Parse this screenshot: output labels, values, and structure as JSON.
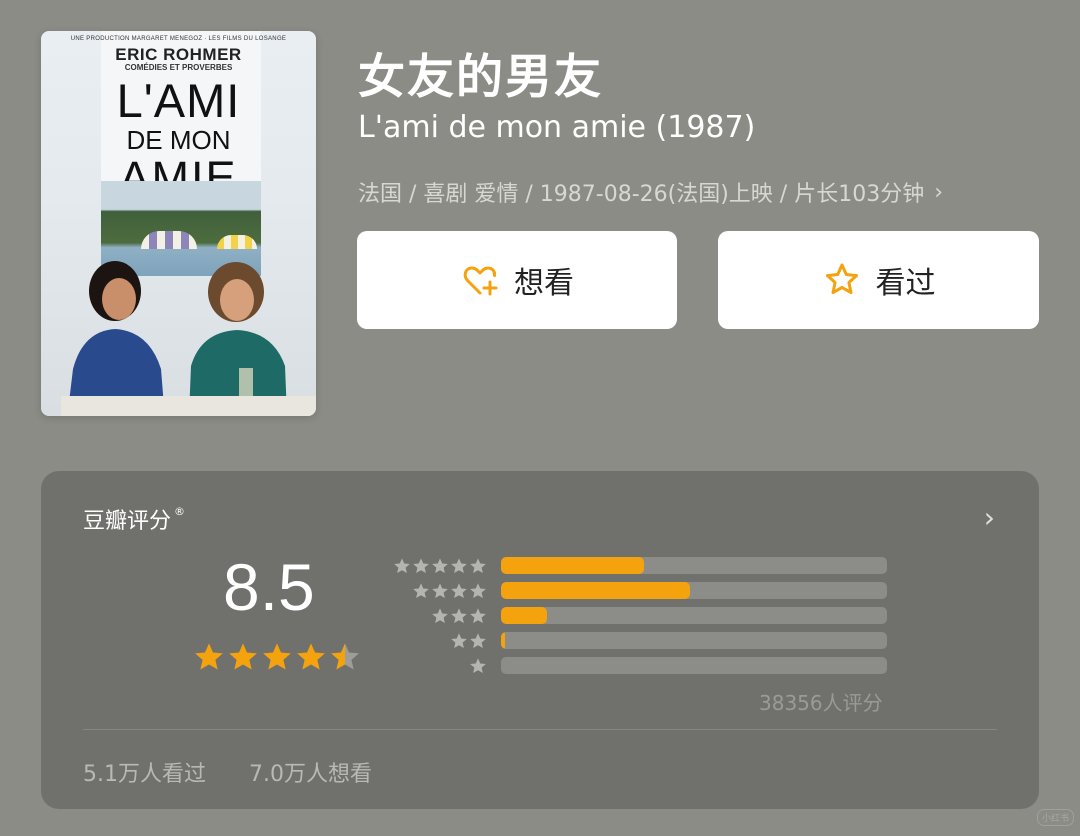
{
  "poster": {
    "production": "UNE PRODUCTION MARGARET MENEGOZ · LES FILMS DU LOSANGE",
    "director": "ERIC ROHMER",
    "series": "COMÉDIES ET PROVERBES",
    "title_l1": "L'AMI",
    "title_l2": "DE MON",
    "title_l3": "AMIE"
  },
  "movie": {
    "title_cn": "女友的男友",
    "title_original": "L'ami de mon amie (1987)",
    "meta": "法国 / 喜剧 爱情 / 1987-08-26(法国)上映 / 片长103分钟",
    "meta_chevron": "›"
  },
  "actions": {
    "want_label": "想看",
    "seen_label": "看过",
    "want_icon": "heart-plus-icon",
    "seen_icon": "star-outline-icon"
  },
  "rating": {
    "label": "豆瓣评分",
    "registered": "®",
    "more": "›",
    "score": "8.5",
    "stars": 4.5,
    "distribution": [
      {
        "stars": 5,
        "fraction": 0.37
      },
      {
        "stars": 4,
        "fraction": 0.49
      },
      {
        "stars": 3,
        "fraction": 0.12
      },
      {
        "stars": 2,
        "fraction": 0.01
      },
      {
        "stars": 1,
        "fraction": 0.0
      }
    ],
    "count_text": "38356人评分",
    "seen_count": "5.1万人看过",
    "want_count": "7.0万人想看"
  },
  "colors": {
    "accent": "#f4a20d",
    "background": "#8c8c86",
    "card": "#70706c",
    "star_gray": "#9d9d99"
  },
  "watermark": "小红书"
}
